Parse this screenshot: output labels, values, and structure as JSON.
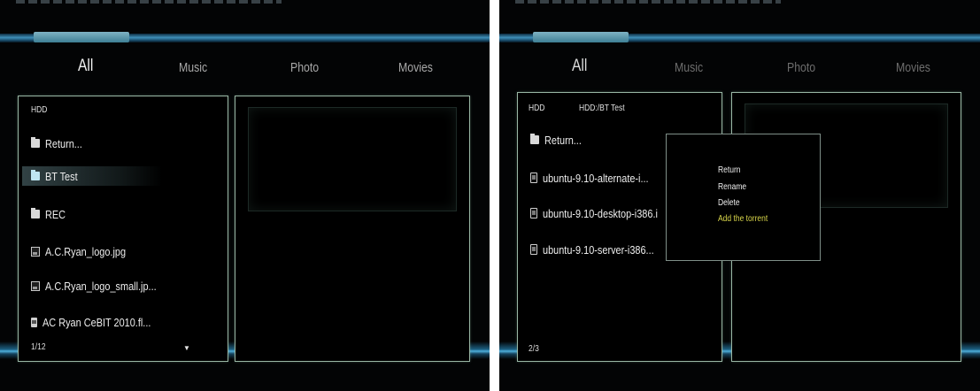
{
  "tabs": [
    "All",
    "Music",
    "Photo",
    "Movies"
  ],
  "left": {
    "path": "HDD",
    "items": [
      {
        "icon": "folder-icon",
        "label": "Return..."
      },
      {
        "icon": "folder-icon",
        "label": "BT Test",
        "selected": true
      },
      {
        "icon": "folder-icon",
        "label": "REC"
      },
      {
        "icon": "image-file-icon",
        "label": "A.C.Ryan_logo.jpg"
      },
      {
        "icon": "image-file-icon",
        "label": "A.C.Ryan_logo_small.jp..."
      },
      {
        "icon": "video-file-icon",
        "label": "AC Ryan CeBIT 2010.fl..."
      }
    ],
    "page": "1/12",
    "more_indicator": "▼"
  },
  "right": {
    "path_root": "HDD",
    "path_current": "HDD:/BT Test",
    "items": [
      {
        "icon": "folder-icon",
        "label": "Return..."
      },
      {
        "icon": "file-icon",
        "label": "ubuntu-9.10-alternate-i..."
      },
      {
        "icon": "file-icon",
        "label": "ubuntu-9.10-desktop-i386.i",
        "selected": true
      },
      {
        "icon": "file-icon",
        "label": "ubuntu-9.10-server-i386..."
      }
    ],
    "page": "2/3",
    "context_menu": {
      "items": [
        "Return",
        "Rename",
        "Delete",
        "Add the torrent"
      ],
      "highlighted": "Add the torrent"
    }
  },
  "colors": {
    "background": "#030405",
    "panel_border": "#9ab7a5",
    "accent_blue": "#4fb0dc",
    "menu_highlight": "#d9d64a"
  }
}
